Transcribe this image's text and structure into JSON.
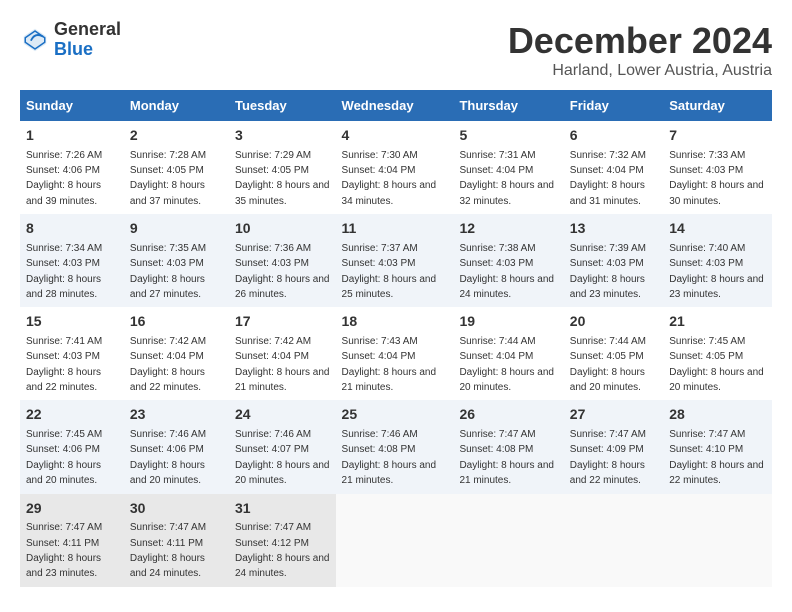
{
  "header": {
    "logo_general": "General",
    "logo_blue": "Blue",
    "month": "December 2024",
    "location": "Harland, Lower Austria, Austria"
  },
  "weekdays": [
    "Sunday",
    "Monday",
    "Tuesday",
    "Wednesday",
    "Thursday",
    "Friday",
    "Saturday"
  ],
  "weeks": [
    [
      {
        "day": "1",
        "sunrise": "Sunrise: 7:26 AM",
        "sunset": "Sunset: 4:06 PM",
        "daylight": "Daylight: 8 hours and 39 minutes."
      },
      {
        "day": "2",
        "sunrise": "Sunrise: 7:28 AM",
        "sunset": "Sunset: 4:05 PM",
        "daylight": "Daylight: 8 hours and 37 minutes."
      },
      {
        "day": "3",
        "sunrise": "Sunrise: 7:29 AM",
        "sunset": "Sunset: 4:05 PM",
        "daylight": "Daylight: 8 hours and 35 minutes."
      },
      {
        "day": "4",
        "sunrise": "Sunrise: 7:30 AM",
        "sunset": "Sunset: 4:04 PM",
        "daylight": "Daylight: 8 hours and 34 minutes."
      },
      {
        "day": "5",
        "sunrise": "Sunrise: 7:31 AM",
        "sunset": "Sunset: 4:04 PM",
        "daylight": "Daylight: 8 hours and 32 minutes."
      },
      {
        "day": "6",
        "sunrise": "Sunrise: 7:32 AM",
        "sunset": "Sunset: 4:04 PM",
        "daylight": "Daylight: 8 hours and 31 minutes."
      },
      {
        "day": "7",
        "sunrise": "Sunrise: 7:33 AM",
        "sunset": "Sunset: 4:03 PM",
        "daylight": "Daylight: 8 hours and 30 minutes."
      }
    ],
    [
      {
        "day": "8",
        "sunrise": "Sunrise: 7:34 AM",
        "sunset": "Sunset: 4:03 PM",
        "daylight": "Daylight: 8 hours and 28 minutes."
      },
      {
        "day": "9",
        "sunrise": "Sunrise: 7:35 AM",
        "sunset": "Sunset: 4:03 PM",
        "daylight": "Daylight: 8 hours and 27 minutes."
      },
      {
        "day": "10",
        "sunrise": "Sunrise: 7:36 AM",
        "sunset": "Sunset: 4:03 PM",
        "daylight": "Daylight: 8 hours and 26 minutes."
      },
      {
        "day": "11",
        "sunrise": "Sunrise: 7:37 AM",
        "sunset": "Sunset: 4:03 PM",
        "daylight": "Daylight: 8 hours and 25 minutes."
      },
      {
        "day": "12",
        "sunrise": "Sunrise: 7:38 AM",
        "sunset": "Sunset: 4:03 PM",
        "daylight": "Daylight: 8 hours and 24 minutes."
      },
      {
        "day": "13",
        "sunrise": "Sunrise: 7:39 AM",
        "sunset": "Sunset: 4:03 PM",
        "daylight": "Daylight: 8 hours and 23 minutes."
      },
      {
        "day": "14",
        "sunrise": "Sunrise: 7:40 AM",
        "sunset": "Sunset: 4:03 PM",
        "daylight": "Daylight: 8 hours and 23 minutes."
      }
    ],
    [
      {
        "day": "15",
        "sunrise": "Sunrise: 7:41 AM",
        "sunset": "Sunset: 4:03 PM",
        "daylight": "Daylight: 8 hours and 22 minutes."
      },
      {
        "day": "16",
        "sunrise": "Sunrise: 7:42 AM",
        "sunset": "Sunset: 4:04 PM",
        "daylight": "Daylight: 8 hours and 22 minutes."
      },
      {
        "day": "17",
        "sunrise": "Sunrise: 7:42 AM",
        "sunset": "Sunset: 4:04 PM",
        "daylight": "Daylight: 8 hours and 21 minutes."
      },
      {
        "day": "18",
        "sunrise": "Sunrise: 7:43 AM",
        "sunset": "Sunset: 4:04 PM",
        "daylight": "Daylight: 8 hours and 21 minutes."
      },
      {
        "day": "19",
        "sunrise": "Sunrise: 7:44 AM",
        "sunset": "Sunset: 4:04 PM",
        "daylight": "Daylight: 8 hours and 20 minutes."
      },
      {
        "day": "20",
        "sunrise": "Sunrise: 7:44 AM",
        "sunset": "Sunset: 4:05 PM",
        "daylight": "Daylight: 8 hours and 20 minutes."
      },
      {
        "day": "21",
        "sunrise": "Sunrise: 7:45 AM",
        "sunset": "Sunset: 4:05 PM",
        "daylight": "Daylight: 8 hours and 20 minutes."
      }
    ],
    [
      {
        "day": "22",
        "sunrise": "Sunrise: 7:45 AM",
        "sunset": "Sunset: 4:06 PM",
        "daylight": "Daylight: 8 hours and 20 minutes."
      },
      {
        "day": "23",
        "sunrise": "Sunrise: 7:46 AM",
        "sunset": "Sunset: 4:06 PM",
        "daylight": "Daylight: 8 hours and 20 minutes."
      },
      {
        "day": "24",
        "sunrise": "Sunrise: 7:46 AM",
        "sunset": "Sunset: 4:07 PM",
        "daylight": "Daylight: 8 hours and 20 minutes."
      },
      {
        "day": "25",
        "sunrise": "Sunrise: 7:46 AM",
        "sunset": "Sunset: 4:08 PM",
        "daylight": "Daylight: 8 hours and 21 minutes."
      },
      {
        "day": "26",
        "sunrise": "Sunrise: 7:47 AM",
        "sunset": "Sunset: 4:08 PM",
        "daylight": "Daylight: 8 hours and 21 minutes."
      },
      {
        "day": "27",
        "sunrise": "Sunrise: 7:47 AM",
        "sunset": "Sunset: 4:09 PM",
        "daylight": "Daylight: 8 hours and 22 minutes."
      },
      {
        "day": "28",
        "sunrise": "Sunrise: 7:47 AM",
        "sunset": "Sunset: 4:10 PM",
        "daylight": "Daylight: 8 hours and 22 minutes."
      }
    ],
    [
      {
        "day": "29",
        "sunrise": "Sunrise: 7:47 AM",
        "sunset": "Sunset: 4:11 PM",
        "daylight": "Daylight: 8 hours and 23 minutes."
      },
      {
        "day": "30",
        "sunrise": "Sunrise: 7:47 AM",
        "sunset": "Sunset: 4:11 PM",
        "daylight": "Daylight: 8 hours and 24 minutes."
      },
      {
        "day": "31",
        "sunrise": "Sunrise: 7:47 AM",
        "sunset": "Sunset: 4:12 PM",
        "daylight": "Daylight: 8 hours and 24 minutes."
      },
      null,
      null,
      null,
      null
    ]
  ]
}
